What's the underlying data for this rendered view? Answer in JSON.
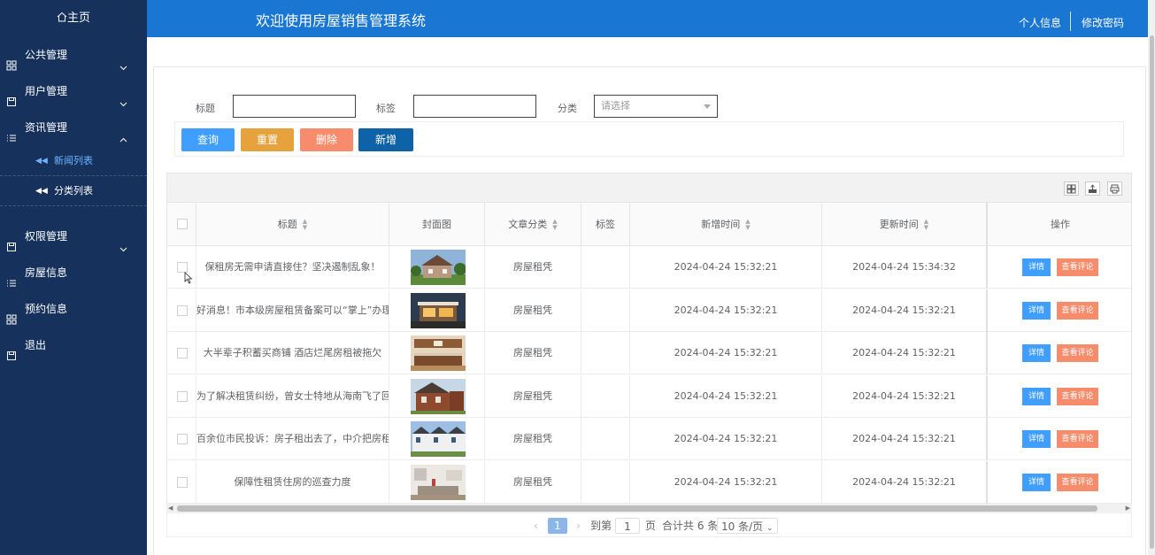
{
  "sidebar": {
    "home": "主页",
    "menus": [
      {
        "label": "公共管理",
        "icon": "grid-icon",
        "chev": "down"
      },
      {
        "label": "用户管理",
        "icon": "save-icon",
        "chev": "down"
      },
      {
        "label": "资讯管理",
        "icon": "list-icon",
        "chev": "up"
      }
    ],
    "subs": [
      {
        "label": "新闻列表",
        "active": true
      },
      {
        "label": "分类列表",
        "active": false
      }
    ],
    "menus2": [
      {
        "label": "权限管理",
        "icon": "save-icon",
        "chev": "down"
      },
      {
        "label": "房屋信息",
        "icon": "list-icon",
        "chev": ""
      },
      {
        "label": "预约信息",
        "icon": "grid-icon",
        "chev": ""
      },
      {
        "label": "退出",
        "icon": "save-icon",
        "chev": ""
      }
    ]
  },
  "header": {
    "title": "欢迎使用房屋销售管理系统",
    "profile": "个人信息",
    "password": "修改密码"
  },
  "filters": {
    "title_label": "标题",
    "tag_label": "标签",
    "category_label": "分类",
    "category_placeholder": "请选择"
  },
  "buttons": {
    "query": "查询",
    "reset": "重置",
    "delete": "删除",
    "add": "新增"
  },
  "colors": {
    "query": "#409eff",
    "reset": "#e6a23c",
    "delete": "#f78c6c",
    "add": "#0d62a8",
    "detail": "#409eff",
    "comment": "#f78c6c"
  },
  "table": {
    "headers": {
      "title": "标题",
      "cover": "封面图",
      "category": "文章分类",
      "tag": "标签",
      "created": "新增时间",
      "updated": "更新时间",
      "actions": "操作"
    },
    "detail_label": "详情",
    "comment_label": "查看评论",
    "rows": [
      {
        "title": "保租房无需申请直接住？坚决遏制乱象！",
        "category": "房屋租凭",
        "tag": "",
        "created": "2024-04-24 15:32:21",
        "updated": "2024-04-24 15:34:32",
        "cover": "house-photo-1"
      },
      {
        "title": "好消息！市本级房屋租赁备案可以“掌上”办理了",
        "category": "房屋租凭",
        "tag": "",
        "created": "2024-04-24 15:32:21",
        "updated": "2024-04-24 15:32:21",
        "cover": "house-photo-2"
      },
      {
        "title": "大半辈子积蓄买商铺 酒店烂尾房租被拖欠",
        "category": "房屋租凭",
        "tag": "",
        "created": "2024-04-24 15:32:21",
        "updated": "2024-04-24 15:32:21",
        "cover": "kitchen-photo"
      },
      {
        "title": "为了解决租赁纠纷，曾女士特地从海南飞了回来",
        "category": "房屋租凭",
        "tag": "",
        "created": "2024-04-24 15:32:21",
        "updated": "2024-04-24 15:32:21",
        "cover": "brick-house-photo"
      },
      {
        "title": "百余位市民投诉：房子租出去了，中介把房租卷跑了",
        "category": "房屋租凭",
        "tag": "",
        "created": "2024-04-24 15:32:21",
        "updated": "2024-04-24 15:32:21",
        "cover": "townhouse-photo"
      },
      {
        "title": "保障性租赁住房的巡查力度",
        "category": "房屋租凭",
        "tag": "",
        "created": "2024-04-24 15:32:21",
        "updated": "2024-04-24 15:32:21",
        "cover": "living-room-photo"
      }
    ]
  },
  "pager": {
    "current": "1",
    "goto": "到第",
    "page_value": "1",
    "page_unit": "页",
    "total": "合计共 6 条",
    "size": "10 条/页"
  }
}
